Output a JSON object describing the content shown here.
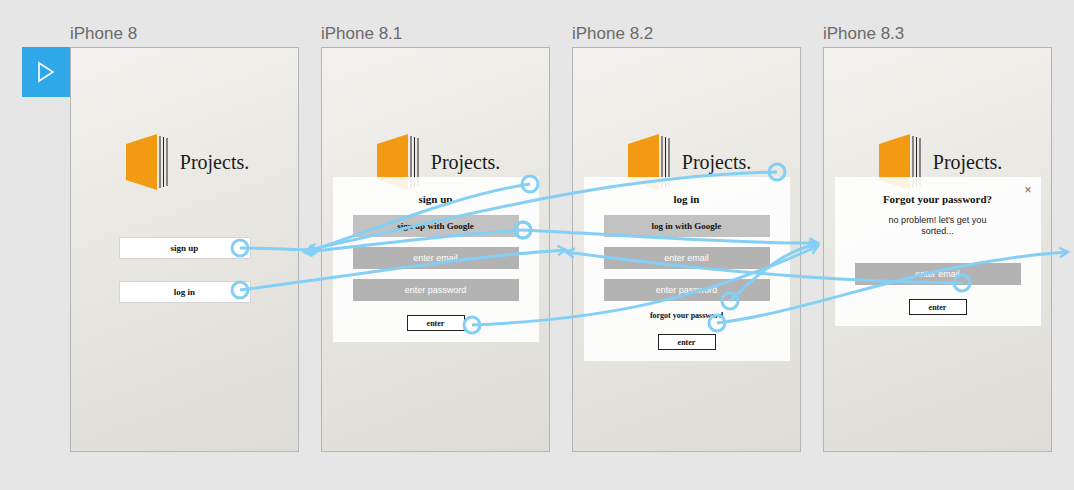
{
  "artboards": [
    {
      "name": "iPhone 8",
      "kind": "welcome",
      "logo": "Projects.",
      "buttons": [
        "sign up",
        "log in"
      ]
    },
    {
      "name": "iPhone 8.1",
      "kind": "form",
      "logo": "Projects.",
      "panel": {
        "title": "sign up",
        "google_button": "sign up with Google",
        "fields": [
          "enter email",
          "enter password"
        ],
        "submit": "enter"
      }
    },
    {
      "name": "iPhone 8.2",
      "kind": "form",
      "logo": "Projects.",
      "panel": {
        "title": "log in",
        "google_button": "log in with Google",
        "fields": [
          "enter email",
          "enter password"
        ],
        "link": "forgot your password",
        "submit": "enter"
      }
    },
    {
      "name": "iPhone 8.3",
      "kind": "form",
      "logo": "Projects.",
      "panel": {
        "close": "×",
        "title": "Forgot your password?",
        "subtitle": "no problem! let's get you sorted...",
        "fields": [
          "enter email"
        ],
        "submit": "enter"
      }
    }
  ]
}
